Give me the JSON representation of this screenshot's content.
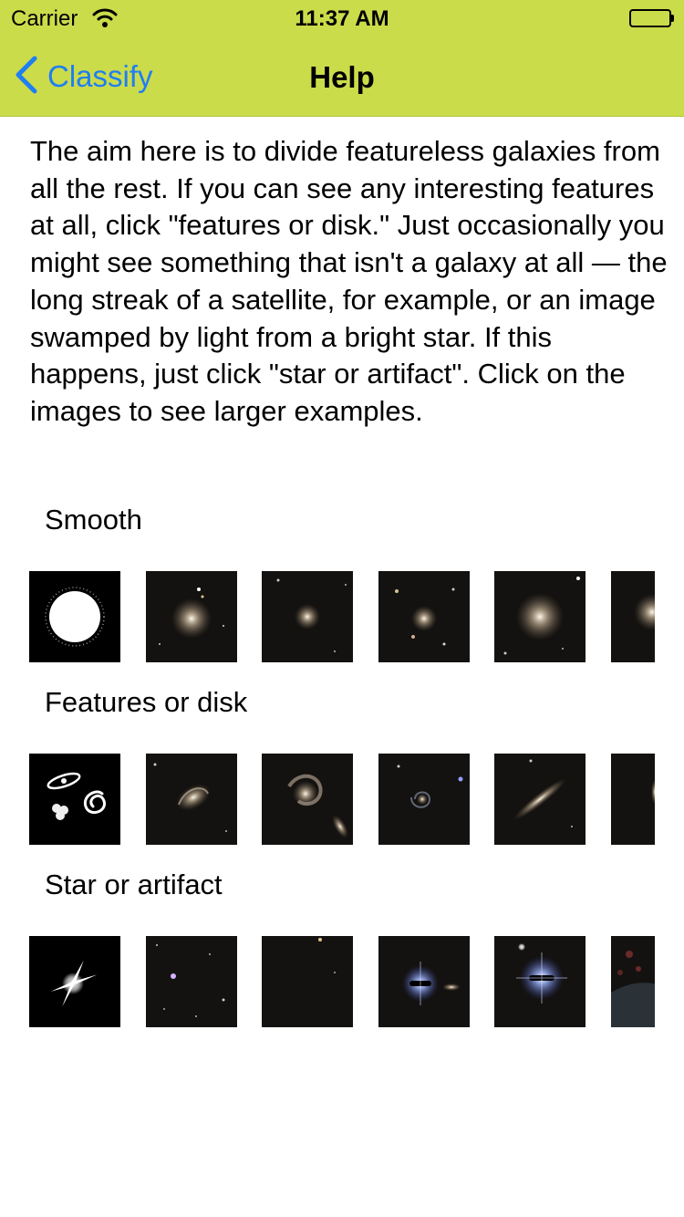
{
  "status_bar": {
    "carrier": "Carrier",
    "time": "11:37 AM",
    "wifi_icon": "wifi-icon",
    "battery_icon": "battery-full-icon"
  },
  "nav": {
    "back_label": "Classify",
    "back_icon": "chevron-left-icon",
    "title": "Help"
  },
  "intro_text": "The aim here is to divide featureless galaxies from all the rest. If you can see any interesting features at all, click \"features or disk.\" Just occasionally you might see something that isn't a galaxy at all — the long streak of a satellite, for example, or an image swamped by light from a bright star. If this happens, just click \"star or artifact\". Click on the images to see larger examples.",
  "sections": [
    {
      "title": "Smooth",
      "icon": "smooth-galaxy-icon",
      "examples": [
        "smooth-example-1",
        "smooth-example-2",
        "smooth-example-3",
        "smooth-example-4",
        "smooth-example-5"
      ]
    },
    {
      "title": "Features or disk",
      "icon": "features-disk-icon",
      "examples": [
        "features-example-1",
        "features-example-2",
        "features-example-3",
        "features-example-4",
        "features-example-5"
      ]
    },
    {
      "title": "Star or artifact",
      "icon": "star-artifact-icon",
      "examples": [
        "star-example-1",
        "star-example-2",
        "star-example-3",
        "star-example-4",
        "star-example-5"
      ]
    }
  ],
  "colors": {
    "header_background": "#cbdc4a",
    "back_accent": "#1f7ef2",
    "thumbnail_background": "#141210"
  }
}
